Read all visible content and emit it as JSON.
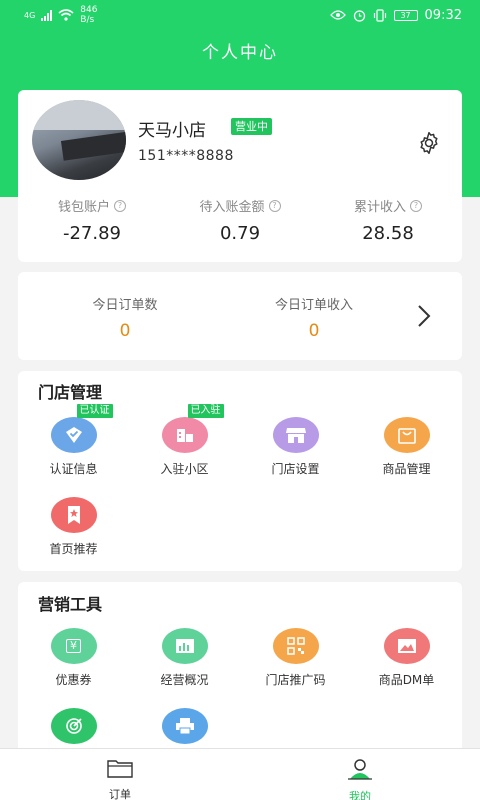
{
  "status_bar": {
    "network": "4G",
    "speed_value": "846",
    "speed_unit": "B/s",
    "battery": "37",
    "time": "09:32"
  },
  "header": {
    "title": "个人中心"
  },
  "profile": {
    "shop_name": "天马小店",
    "status": "营业中",
    "phone": "151****8888",
    "stats": [
      {
        "label": "钱包账户",
        "value": "-27.89"
      },
      {
        "label": "待入账金额",
        "value": "0.79"
      },
      {
        "label": "累计收入",
        "value": "28.58"
      }
    ]
  },
  "orders": {
    "today_count_label": "今日订单数",
    "today_count": "0",
    "today_income_label": "今日订单收入",
    "today_income": "0"
  },
  "store_management": {
    "title": "门店管理",
    "items": [
      {
        "label": "认证信息",
        "badge": "已认证",
        "icon": "verified-badge-icon",
        "color": "#6aa6e8"
      },
      {
        "label": "入驻小区",
        "badge": "已入驻",
        "icon": "community-building-icon",
        "color": "#f08aa6"
      },
      {
        "label": "门店设置",
        "icon": "storefront-icon",
        "color": "#b79be6"
      },
      {
        "label": "商品管理",
        "icon": "shopping-bag-icon",
        "color": "#f5a64a"
      },
      {
        "label": "首页推荐",
        "icon": "star-bookmark-icon",
        "color": "#f06a6a"
      }
    ]
  },
  "marketing": {
    "title": "营销工具",
    "items": [
      {
        "label": "优惠券",
        "icon": "coupon-yen-icon",
        "glyph": "¥",
        "color": "#5fd29a"
      },
      {
        "label": "经营概况",
        "icon": "bar-chart-icon",
        "color": "#5fd29a"
      },
      {
        "label": "门店推广码",
        "icon": "qr-code-icon",
        "color": "#f5a64a"
      },
      {
        "label": "商品DM单",
        "icon": "image-flyer-icon",
        "color": "#f07878"
      },
      {
        "label": "",
        "icon": "target-icon",
        "color": "#2fc46a"
      },
      {
        "label": "",
        "icon": "printer-icon",
        "color": "#5aa6e8"
      }
    ]
  },
  "tabbar": [
    {
      "label": "订单",
      "icon": "folder-icon",
      "active": false
    },
    {
      "label": "我的",
      "icon": "user-profile-icon",
      "active": true
    }
  ]
}
